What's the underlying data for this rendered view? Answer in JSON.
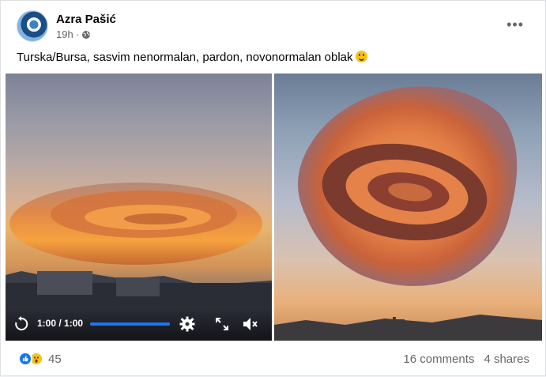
{
  "post": {
    "author": "Azra Pašić",
    "time": "19h",
    "privacy_icon": "globe-icon",
    "more_icon": "more-options-icon",
    "caption": "Turska/Bursa, sasvim nenormalan, pardon, novonormalan oblak"
  },
  "video": {
    "time_label": "1:00 / 1:00",
    "progress": 1.0,
    "icons": [
      "replay-icon",
      "settings-icon",
      "fullscreen-icon",
      "mute-icon"
    ]
  },
  "footer": {
    "reaction_count": "45",
    "reaction_icons": [
      "like-icon",
      "wow-icon"
    ],
    "comments": "16 comments",
    "shares": "4 shares"
  },
  "colors": {
    "accent": "#1877f2",
    "secondary_text": "#65676b",
    "cloud_orange": "#f08a3a",
    "cloud_dark": "#8a3c2a"
  }
}
